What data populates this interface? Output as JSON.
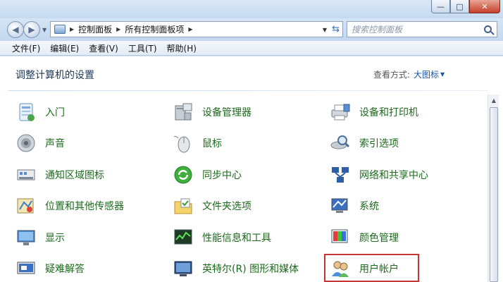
{
  "window": {
    "buttons": {
      "minimize": "—",
      "maximize": "□",
      "close": "✕"
    }
  },
  "nav": {
    "back_glyph": "◀",
    "forward_glyph": "▶",
    "breadcrumb": [
      "控制面板",
      "所有控制面板项"
    ],
    "crumb_sep": "▶",
    "search_placeholder": "搜索控制面板"
  },
  "menu": [
    "文件(F)",
    "编辑(E)",
    "查看(V)",
    "工具(T)",
    "帮助(H)"
  ],
  "content": {
    "title": "调整计算机的设置",
    "view_by_label": "查看方式:",
    "view_by_value": "大图标"
  },
  "items": [
    {
      "label": "入门",
      "icon": "getting-started-icon"
    },
    {
      "label": "设备管理器",
      "icon": "device-manager-icon"
    },
    {
      "label": "设备和打印机",
      "icon": "printer-icon"
    },
    {
      "label": "声音",
      "icon": "speaker-icon"
    },
    {
      "label": "鼠标",
      "icon": "mouse-icon"
    },
    {
      "label": "索引选项",
      "icon": "index-options-icon"
    },
    {
      "label": "通知区域图标",
      "icon": "notification-area-icon"
    },
    {
      "label": "同步中心",
      "icon": "sync-center-icon"
    },
    {
      "label": "网络和共享中心",
      "icon": "network-icon"
    },
    {
      "label": "位置和其他传感器",
      "icon": "location-sensor-icon"
    },
    {
      "label": "文件夹选项",
      "icon": "folder-options-icon"
    },
    {
      "label": "系统",
      "icon": "system-icon"
    },
    {
      "label": "显示",
      "icon": "display-icon"
    },
    {
      "label": "性能信息和工具",
      "icon": "performance-icon"
    },
    {
      "label": "颜色管理",
      "icon": "color-management-icon"
    },
    {
      "label": "疑难解答",
      "icon": "troubleshooting-icon"
    },
    {
      "label": "英特尔(R) 图形和媒体",
      "icon": "intel-graphics-icon"
    },
    {
      "label": "用户帐户",
      "icon": "user-accounts-icon"
    }
  ],
  "colors": {
    "link_green": "#1c6a1c",
    "highlight_border": "#c93434",
    "title_blue": "#1e395b"
  }
}
